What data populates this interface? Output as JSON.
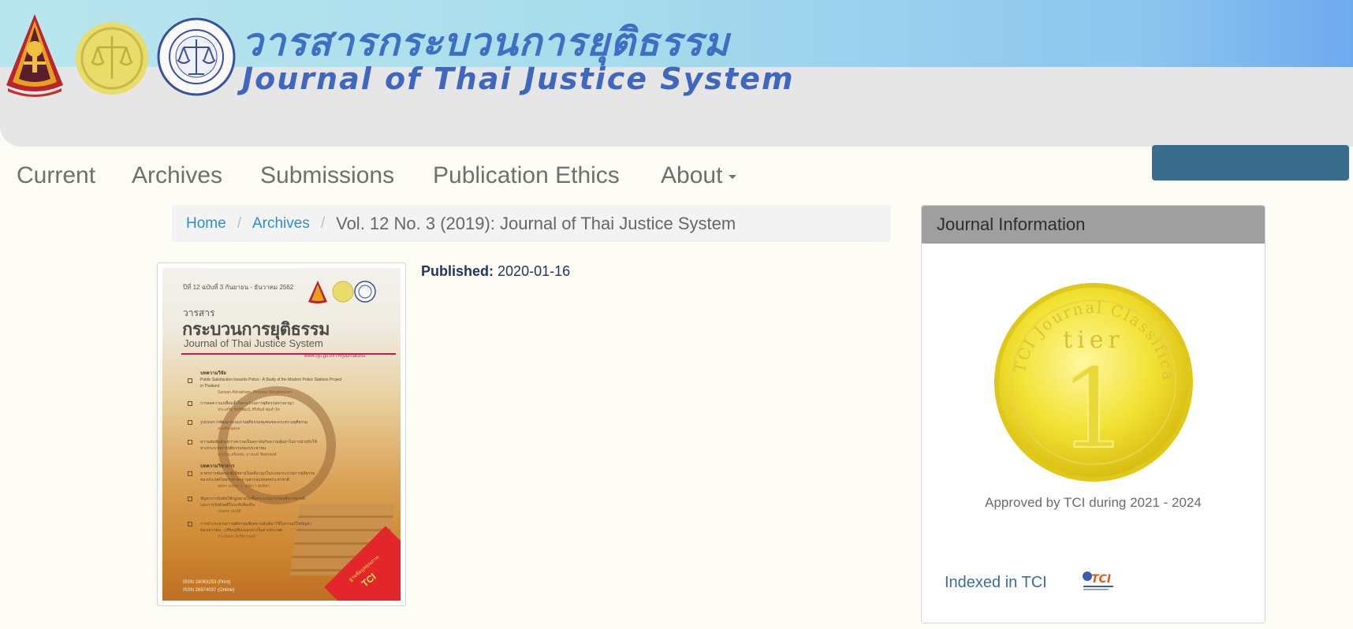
{
  "header": {
    "title_thai": "วารสารกระบวนการยุติธรรม",
    "title_english": "Journal of Thai Justice System",
    "colors": {
      "blue_band": "#a8dcec",
      "grey_band": "#e6e6e6",
      "title": "#3d6fc2"
    }
  },
  "nav": {
    "items": [
      {
        "label": "Current"
      },
      {
        "label": "Archives"
      },
      {
        "label": "Submissions"
      },
      {
        "label": "Publication Ethics"
      },
      {
        "label": "About"
      }
    ],
    "about_caret_icon": "caret-down-icon"
  },
  "breadcrumb": {
    "home": "Home",
    "archives": "Archives",
    "separator": "/",
    "current": "Vol. 12 No. 3 (2019): Journal of Thai Justice System"
  },
  "issue": {
    "published_label": "Published:",
    "published_date": "2020-01-16"
  },
  "cover": {
    "volume_line": "ปีที่ 12 ฉบับที่ 3 กันยายน - ธันวาคม 2562",
    "prefix": "วารสาร",
    "title_thai": "กระบวนการยุติธรรม",
    "title_english": "Journal of Thai Justice System",
    "url": "www.ojs.go.th/TH/journalofts/",
    "section_research": "บทความวิจัย",
    "article_1": "Public Satisfaction towards Police : A Study of the Modern Police Stations Project",
    "article_1b": "in Thailand",
    "article_1_authors": "Sansan Abhakham, Pinnapa Mongkholsmi",
    "article_2": "การลดความเหลื่อมล้ำในกระบวนการยุติธรรมทางอาญา",
    "article_2_authors": "ประเสริฐ ชัยพิพัฒน์, ศิริพันธ์ พุ่มจำรัส",
    "article_3": "รูปแบบการพัฒนาระบบงานยุติธรรมชุมชนของกระทรวงยุติธรรม",
    "article_3_authors": "ภณชัช จุลกุล",
    "article_4": "ความสัมพันธ์ระหว่างความเป็นสถาบันกับความคุ้มค่าในการนำปรับใช้",
    "article_4b": "ทางกระบวนการยุติธรรมของประชาชน",
    "article_4_authors": "สุวรรณ สนิทสุข, อานนท์ ชัยสุรพงศ์",
    "section_academic": "บทความวิชาการ",
    "article_5": "มาตรการคุ้มครองผู้เสียหายในคดีอาญาในระบบกระบวนการยุติธรรม",
    "article_5b": "ของประเทศไทยกับมาตรฐานสากลแห่งสหประชาชาติ",
    "article_5_authors": "สมัคร ทองขาว, สุพัตรา สุทธิศร",
    "article_6": "ปัญหาการบังคับใช้กฎหมายในชั้นกระบวนการก่อนพิจารณาคดี",
    "article_6b": "และการบังคับคดีในระดับท้องถิ่น",
    "article_6_authors": "กมลพร สมบัติ",
    "article_7": "การนำกระบวนการยุติธรรมเชิงสมานฉันท์มาใช้ในการแก้ไขปัญหา",
    "article_7b": "ของเยาวชน : เปรียบเทียบแนวทางในต่างประเทศ",
    "article_7_authors": "ประภัสสร ลักขิตานนท์",
    "issn_print": "ISSN 18063253 (Print)",
    "issn_online": "ISSN 26974037 (Online)",
    "badge_label": "TCI",
    "badge_sub": "ฐานข้อมูลคุณภาพ"
  },
  "sidebar": {
    "title": "Journal Information",
    "medal_ring_text": "TCI Journal Classification",
    "medal_tier": "tier",
    "medal_number": "1",
    "approved_text": "Approved by TCI during 2021 - 2024",
    "indexed_label": "Indexed in TCI",
    "tci_logo_text": "TCI"
  }
}
